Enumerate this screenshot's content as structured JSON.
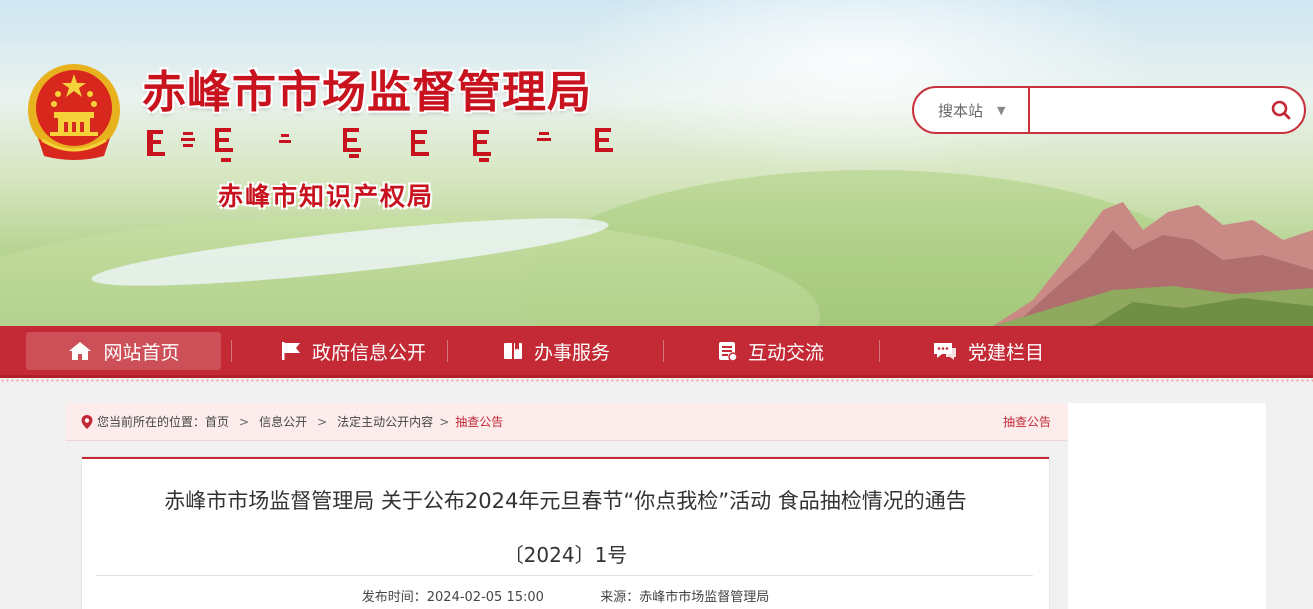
{
  "header": {
    "title": "赤峰市市场监督管理局",
    "subtitle": "赤峰市知识产权局",
    "mongolian_icon": "mongolian-script-title",
    "emblem_icon": "national-emblem-icon"
  },
  "search": {
    "scope_label": "搜本站",
    "placeholder": "",
    "value": ""
  },
  "nav": {
    "items": [
      {
        "label": "网站首页",
        "icon": "home-icon",
        "active": true
      },
      {
        "label": "政府信息公开",
        "icon": "flag-icon"
      },
      {
        "label": "办事服务",
        "icon": "book-icon"
      },
      {
        "label": "互动交流",
        "icon": "clipboard-icon"
      },
      {
        "label": "党建栏目",
        "icon": "chat-icon"
      }
    ]
  },
  "breadcrumb": {
    "prefix": "您当前所在的位置：",
    "items": [
      "首页",
      "信息公开",
      "法定主动公开内容",
      "抽查公告"
    ],
    "section_label": "抽查公告"
  },
  "article": {
    "title": "赤峰市市场监督管理局 关于公布2024年元旦春节“你点我检”活动 食品抽检情况的通告",
    "doc_no": "〔2024〕1号",
    "publish_label": "发布时间：",
    "publish_time": "2024-02-05 15:00",
    "source_label": "来源：",
    "source": "赤峰市市场监督管理局"
  },
  "colors": {
    "primary_red": "#c32a35",
    "title_red": "#c8121e",
    "breadcrumb_bg": "#fcecec"
  }
}
